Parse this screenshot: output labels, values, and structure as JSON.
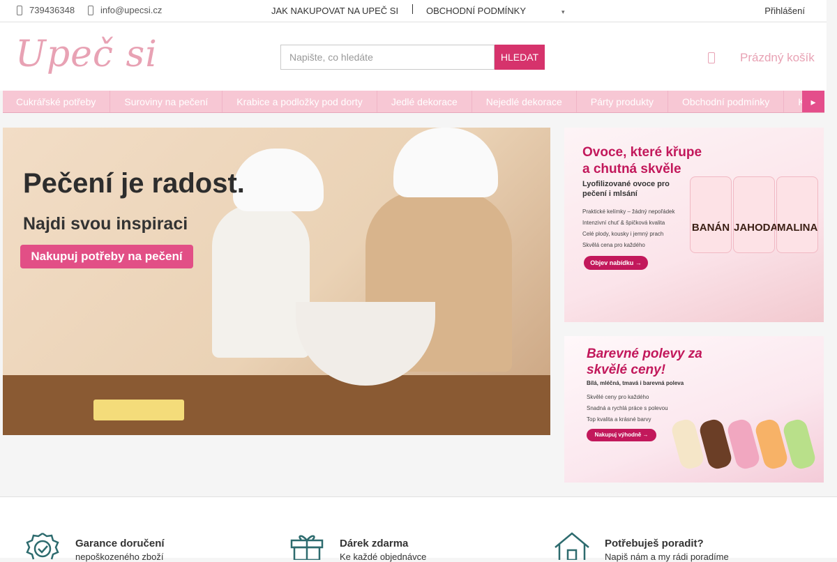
{
  "topbar": {
    "phone": "739436348",
    "email": "info@upecsi.cz",
    "how_to_shop": "JAK NAKUPOVAT NA UPEČ SI",
    "terms": "OBCHODNÍ PODMÍNKY",
    "login": "Přihlášení"
  },
  "header": {
    "logo": "Upeč si",
    "search_placeholder": "Napište, co hledáte",
    "search_button": "Hledat",
    "cart_label": "Prázdný košík"
  },
  "nav": {
    "items": [
      "Cukrářské potřeby",
      "Suroviny na pečení",
      "Krabice a podložky pod dorty",
      "Jedlé dekorace",
      "Nejedlé dekorace",
      "Párty produkty",
      "Obchodní podmínky",
      "K"
    ]
  },
  "hero": {
    "headline": "Pečení je radost.",
    "subheadline": "Najdi svou inspiraci",
    "cta": "Nakupuj potřeby na pečení"
  },
  "banner1": {
    "title": "Ovoce, které křupe a chutná skvěle",
    "subtitle": "Lyofilizované ovoce pro pečení i mlsání",
    "bullets": [
      "Praktické kelímky – žádný nepořádek",
      "Intenzivní chuť & špičková kvalita",
      "Celé plody, kousky i jemný prach",
      "Skvělá cena pro každého"
    ],
    "button": "Objev nabídku →",
    "jars": [
      "BANÁN",
      "JAHODA",
      "MALINA"
    ]
  },
  "banner2": {
    "title": "Barevné polevy za skvělé ceny!",
    "subtitle": "Bílá, mléčná, tmavá i barevná poleva",
    "bullets": [
      "Skvělé ceny pro každého",
      "Snadná a rychlá práce s polevou",
      "Top kvalita a krásné barvy"
    ],
    "button": "Nakupuj výhodně →"
  },
  "benefits": [
    {
      "title": "Garance doručení",
      "sub": "nepoškozeného zboží"
    },
    {
      "title": "Dárek zdarma",
      "sub": "Ke každé objednávce"
    },
    {
      "title": "Potřebuješ poradit?",
      "sub": "Napiš nám a my rádi poradíme"
    }
  ],
  "colors": {
    "brand_pink": "#d6336c",
    "nav_bg": "#f7c7d4",
    "logo_pink": "#e8a2b4",
    "icon_teal": "#2d6b6e"
  }
}
